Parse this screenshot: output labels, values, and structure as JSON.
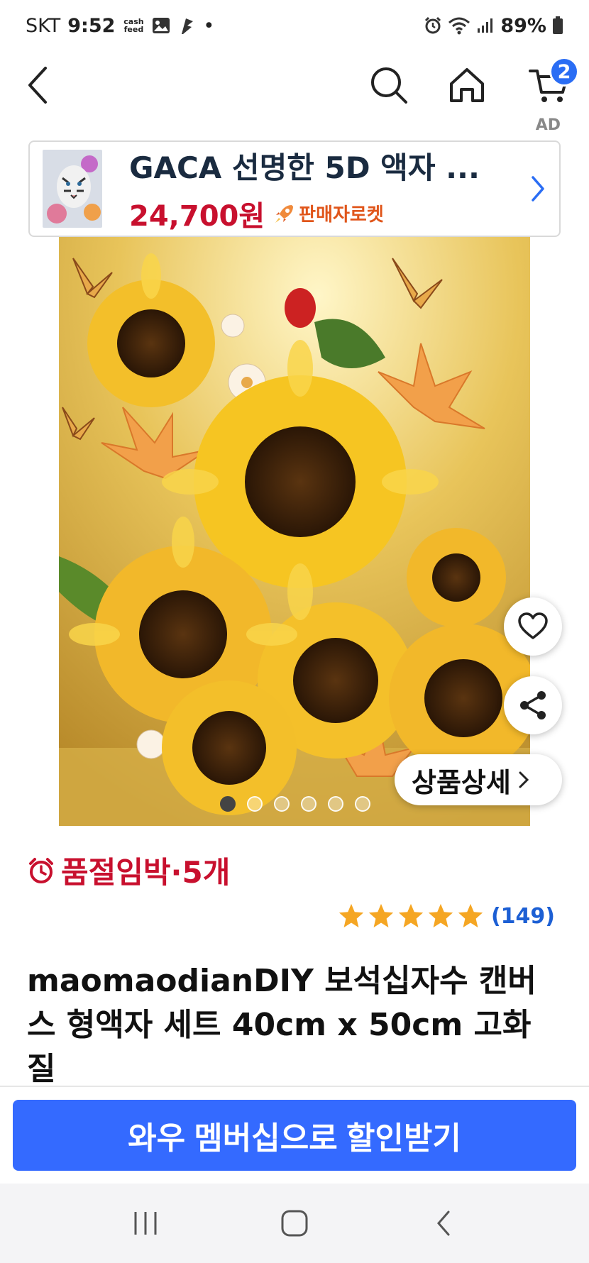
{
  "status_bar": {
    "carrier": "SKT",
    "time": "9:52",
    "cashfeed": "cash feed",
    "dot": "•",
    "battery": "89%"
  },
  "header": {
    "cart_count": "2"
  },
  "ad": {
    "label": "AD",
    "title": "GACA 선명한 5D 액자 ...",
    "price": "24,700원",
    "badge": "판매자로켓"
  },
  "gallery": {
    "detail_label": "상품상세",
    "dot_count": 6,
    "active_dot": 0
  },
  "stock": {
    "text": "품절임박·5개"
  },
  "rating": {
    "stars": 5,
    "count": "(149)"
  },
  "product": {
    "title": "maomaodianDIY 보석십자수 캔버스 형액자 세트 40cm x 50cm 고화질"
  },
  "cta": {
    "label": "와우 멤버십으로 할인받기"
  },
  "colors": {
    "accent": "#346aff",
    "sale_red": "#c8102e",
    "rocket_orange": "#e0561b",
    "link_blue": "#1c5fd4",
    "star_gold": "#f5a623"
  }
}
